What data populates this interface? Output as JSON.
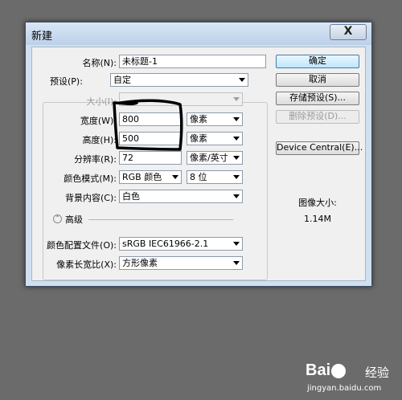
{
  "dialog": {
    "title": "新建",
    "close_label": "X"
  },
  "form": {
    "name": {
      "label": "名称(N):",
      "value": "未标题-1"
    },
    "preset": {
      "label": "预设(P):",
      "value": "自定"
    },
    "size": {
      "label": "大小(I):",
      "value": ""
    },
    "width": {
      "label": "宽度(W):",
      "value": "800",
      "unit": "像素"
    },
    "height": {
      "label": "高度(H):",
      "value": "500",
      "unit": "像素"
    },
    "resolution": {
      "label": "分辨率(R):",
      "value": "72",
      "unit": "像素/英寸"
    },
    "color_mode": {
      "label": "颜色模式(M):",
      "value": "RGB 颜色",
      "bits": "8 位"
    },
    "background": {
      "label": "背景内容(C):",
      "value": "白色"
    },
    "advanced": {
      "label": "高级"
    },
    "color_profile": {
      "label": "颜色配置文件(O):",
      "value": "sRGB IEC61966-2.1"
    },
    "pixel_aspect": {
      "label": "像素长宽比(X):",
      "value": "方形像素"
    }
  },
  "buttons": {
    "ok": "确定",
    "cancel": "取消",
    "save_preset": "存储预设(S)...",
    "delete_preset": "删除预设(D)...",
    "device_central": "Device Central(E)..."
  },
  "image_size": {
    "label": "图像大小:",
    "value": "1.14M"
  },
  "watermark": {
    "logo": "Bai",
    "logo_suffix": "经验",
    "url": "jingyan.baidu.com"
  }
}
